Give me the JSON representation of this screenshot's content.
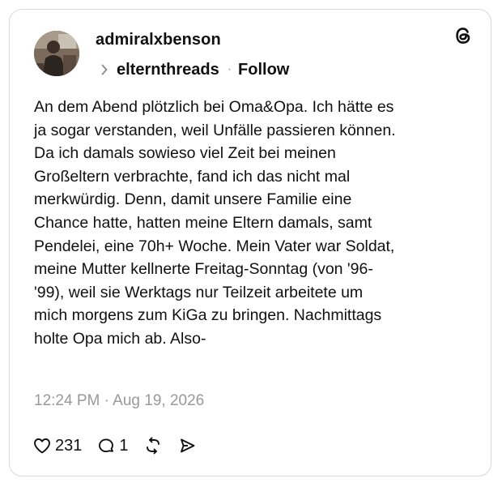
{
  "post": {
    "username": "admiralxbenson",
    "community": "elternthreads",
    "separator": "·",
    "follow_label": "Follow",
    "body_lines": [
      "An dem Abend plötzlich bei Oma&Opa. Ich hätte es",
      "ja sogar verstanden, weil Unfälle passieren können.",
      "Da ich damals sowieso viel Zeit bei meinen",
      "Großeltern verbrachte, fand ich das nicht mal",
      "merkwürdig. Denn, damit unsere Familie eine",
      "Chance hatte, hatten meine Eltern damals, samt",
      "Pendelei, eine 70h+ Woche. Mein Vater war Soldat,",
      "meine Mutter kellnerte Freitag-Sonntag (von '96-",
      "'99), weil sie Werktags nur Teilzeit arbeitete um",
      "mich morgens zum KiGa zu bringen. Nachmittags",
      "holte Opa mich ab. Also-"
    ],
    "timestamp": "12:24 PM · Aug 19, 2026"
  },
  "actions": {
    "like_count": "231",
    "reply_count": "1"
  },
  "icons": {
    "avatar": "avatar",
    "logo": "threads-logo-icon",
    "chevron": "chevron-right-icon",
    "like": "heart-icon",
    "reply": "comment-icon",
    "repost": "repost-icon",
    "share": "send-icon"
  },
  "colors": {
    "text": "#101010",
    "muted": "#999999",
    "border": "#d9d9d9"
  }
}
